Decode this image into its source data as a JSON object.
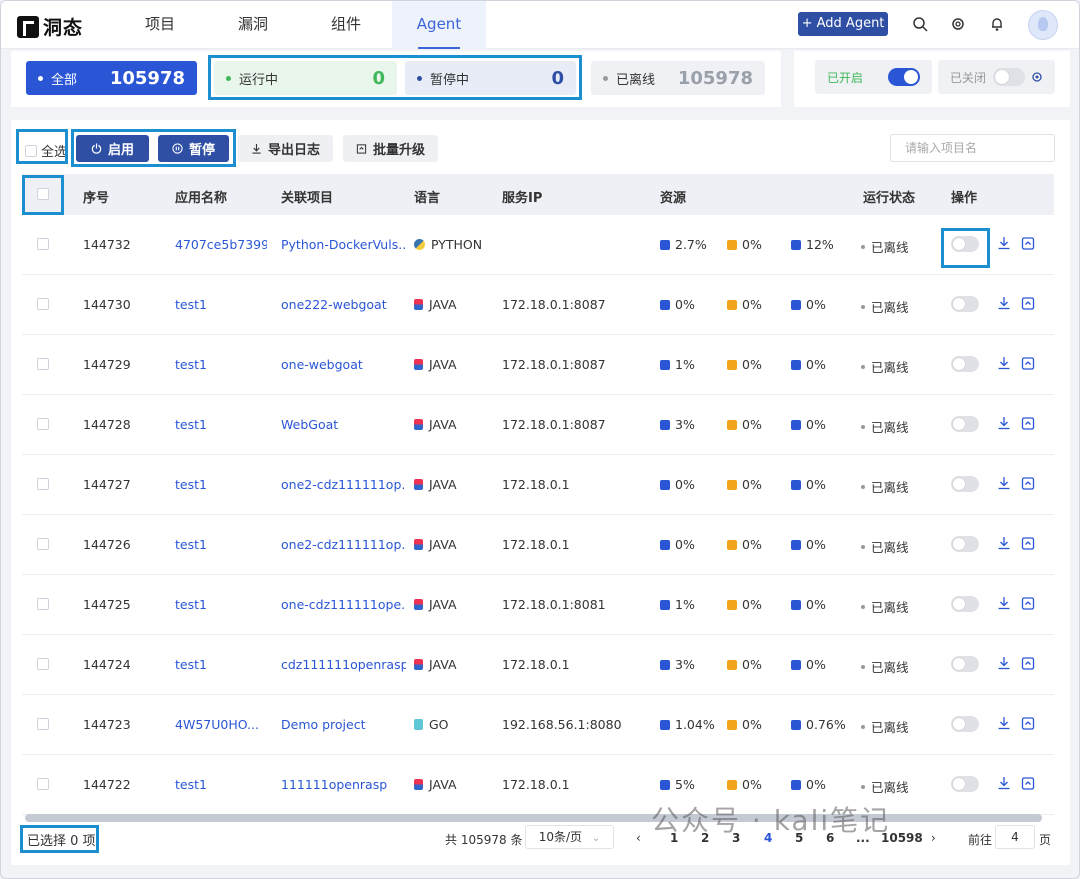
{
  "header": {
    "logo_text": "洞态",
    "nav": [
      "项目",
      "漏洞",
      "组件",
      "Agent"
    ],
    "add_agent": "+ Add Agent"
  },
  "summary": {
    "all_label": "全部",
    "all_count": "105978",
    "running_label": "运行中",
    "running_count": "0",
    "paused_label": "暂停中",
    "paused_count": "0",
    "offline_label": "已离线",
    "offline_count": "105978",
    "enabled_label": "已开启",
    "disabled_label": "已关闭"
  },
  "toolbar": {
    "select_all": "全选",
    "start": "启用",
    "pause": "暂停",
    "export_log": "导出日志",
    "batch_upgrade": "批量升级",
    "search_placeholder": "请输入项目名"
  },
  "columns": [
    "序号",
    "应用名称",
    "关联项目",
    "语言",
    "服务IP",
    "资源",
    "运行状态",
    "操作"
  ],
  "rows": [
    {
      "id": "144732",
      "app": "4707ce5b7399",
      "project": "Python-DockerVuls...",
      "lang": "PYTHON",
      "lang_icon": "python",
      "ip": "",
      "cpu": "2.7%",
      "mem": "0%",
      "disk": "12%",
      "status": "已离线"
    },
    {
      "id": "144730",
      "app": "test1",
      "project": "one222-webgoat",
      "lang": "JAVA",
      "lang_icon": "java",
      "ip": "172.18.0.1:8087",
      "cpu": "0%",
      "mem": "0%",
      "disk": "0%",
      "status": "已离线"
    },
    {
      "id": "144729",
      "app": "test1",
      "project": "one-webgoat",
      "lang": "JAVA",
      "lang_icon": "java",
      "ip": "172.18.0.1:8087",
      "cpu": "1%",
      "mem": "0%",
      "disk": "0%",
      "status": "已离线"
    },
    {
      "id": "144728",
      "app": "test1",
      "project": "WebGoat",
      "lang": "JAVA",
      "lang_icon": "java",
      "ip": "172.18.0.1:8087",
      "cpu": "3%",
      "mem": "0%",
      "disk": "0%",
      "status": "已离线"
    },
    {
      "id": "144727",
      "app": "test1",
      "project": "one2-cdz111111op...",
      "lang": "JAVA",
      "lang_icon": "java",
      "ip": "172.18.0.1",
      "cpu": "0%",
      "mem": "0%",
      "disk": "0%",
      "status": "已离线"
    },
    {
      "id": "144726",
      "app": "test1",
      "project": "one2-cdz111111op...",
      "lang": "JAVA",
      "lang_icon": "java",
      "ip": "172.18.0.1",
      "cpu": "0%",
      "mem": "0%",
      "disk": "0%",
      "status": "已离线"
    },
    {
      "id": "144725",
      "app": "test1",
      "project": "one-cdz111111ope...",
      "lang": "JAVA",
      "lang_icon": "java",
      "ip": "172.18.0.1:8081",
      "cpu": "1%",
      "mem": "0%",
      "disk": "0%",
      "status": "已离线"
    },
    {
      "id": "144724",
      "app": "test1",
      "project": "cdz111111openrasp",
      "lang": "JAVA",
      "lang_icon": "java",
      "ip": "172.18.0.1",
      "cpu": "3%",
      "mem": "0%",
      "disk": "0%",
      "status": "已离线"
    },
    {
      "id": "144723",
      "app": "4W57U0HO...",
      "project": "Demo project",
      "lang": "GO",
      "lang_icon": "go",
      "ip": "192.168.56.1:8080",
      "cpu": "1.04%",
      "mem": "0%",
      "disk": "0.76%",
      "status": "已离线"
    },
    {
      "id": "144722",
      "app": "test1",
      "project": "111111openrasp",
      "lang": "JAVA",
      "lang_icon": "java",
      "ip": "172.18.0.1",
      "cpu": "5%",
      "mem": "0%",
      "disk": "0%",
      "status": "已离线"
    }
  ],
  "footer": {
    "selected": "已选择 0 项",
    "total": "共 105978 条",
    "page_size": "10条/页",
    "pages": [
      "1",
      "2",
      "3",
      "4",
      "5",
      "6",
      "...",
      "10598"
    ],
    "current_page": "4",
    "goto_label": "前往",
    "goto_value": "4",
    "page_suffix": "页"
  },
  "watermark": "公众号 · kali笔记",
  "colors": {
    "accent": "#2a56d6",
    "dark_button": "#2f4fa5",
    "running": "#3fb85a",
    "highlight_box": "#1b8fd0"
  }
}
